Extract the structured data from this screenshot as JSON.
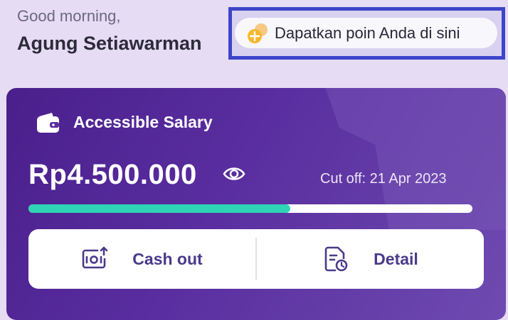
{
  "header": {
    "greeting": "Good morning,",
    "username": "Agung Setiawarman"
  },
  "points": {
    "label": "Dapatkan poin Anda di sini",
    "icon": "coin-icon"
  },
  "salary_card": {
    "title": "Accessible Salary",
    "icon": "wallet-icon",
    "amount": "Rp4.500.000",
    "visibility_icon": "eye-icon",
    "cutoff_label": "Cut off: 21 Apr 2023",
    "progress_fraction": 0.59,
    "colors": {
      "progress_fill": "#2fd3b5",
      "card_bg": "#4a1f8c"
    }
  },
  "actions": [
    {
      "label": "Cash out",
      "icon": "cash-out-icon"
    },
    {
      "label": "Detail",
      "icon": "detail-document-icon"
    }
  ]
}
